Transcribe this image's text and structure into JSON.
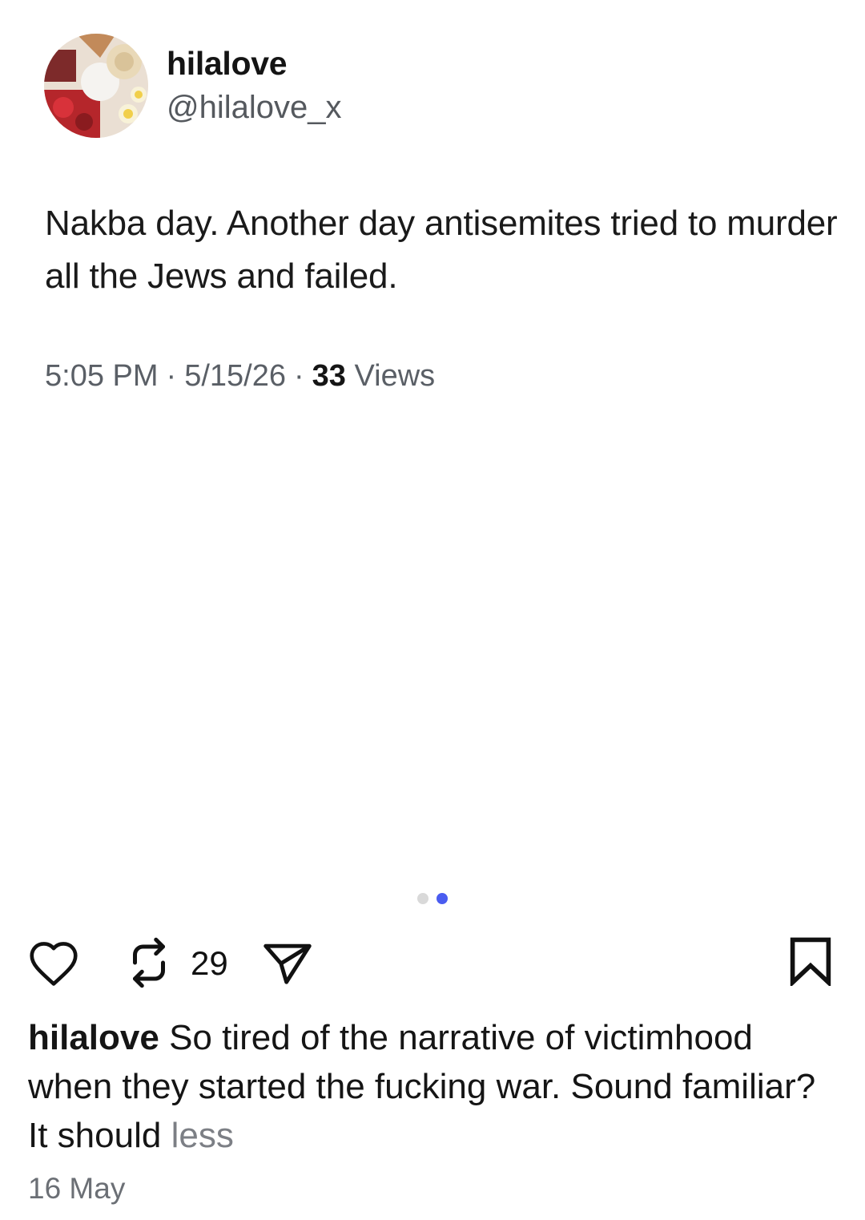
{
  "tweet": {
    "display_name": "hilalove",
    "handle": "@hilalove_x",
    "text": "Nakba day. Another day antisemites tried to murder all the Jews and failed.",
    "time": "5:05 PM",
    "date": "5/15/26",
    "separator": "·",
    "views_count": "33",
    "views_label": "Views"
  },
  "carousel": {
    "dot_count": 2,
    "active_index": 1,
    "active_color": "#4a5cf0",
    "inactive_color": "#d9d9d9"
  },
  "actions": {
    "like_icon": "heart-outline-icon",
    "repost_icon": "repost-icon",
    "repost_count": "29",
    "share_icon": "send-icon",
    "bookmark_icon": "bookmark-icon"
  },
  "caption": {
    "username": "hilalove",
    "text": "So tired of the narrative of victimhood when they started the fucking war. Sound familiar? It should",
    "less_label": "less"
  },
  "post_date": "16 May"
}
